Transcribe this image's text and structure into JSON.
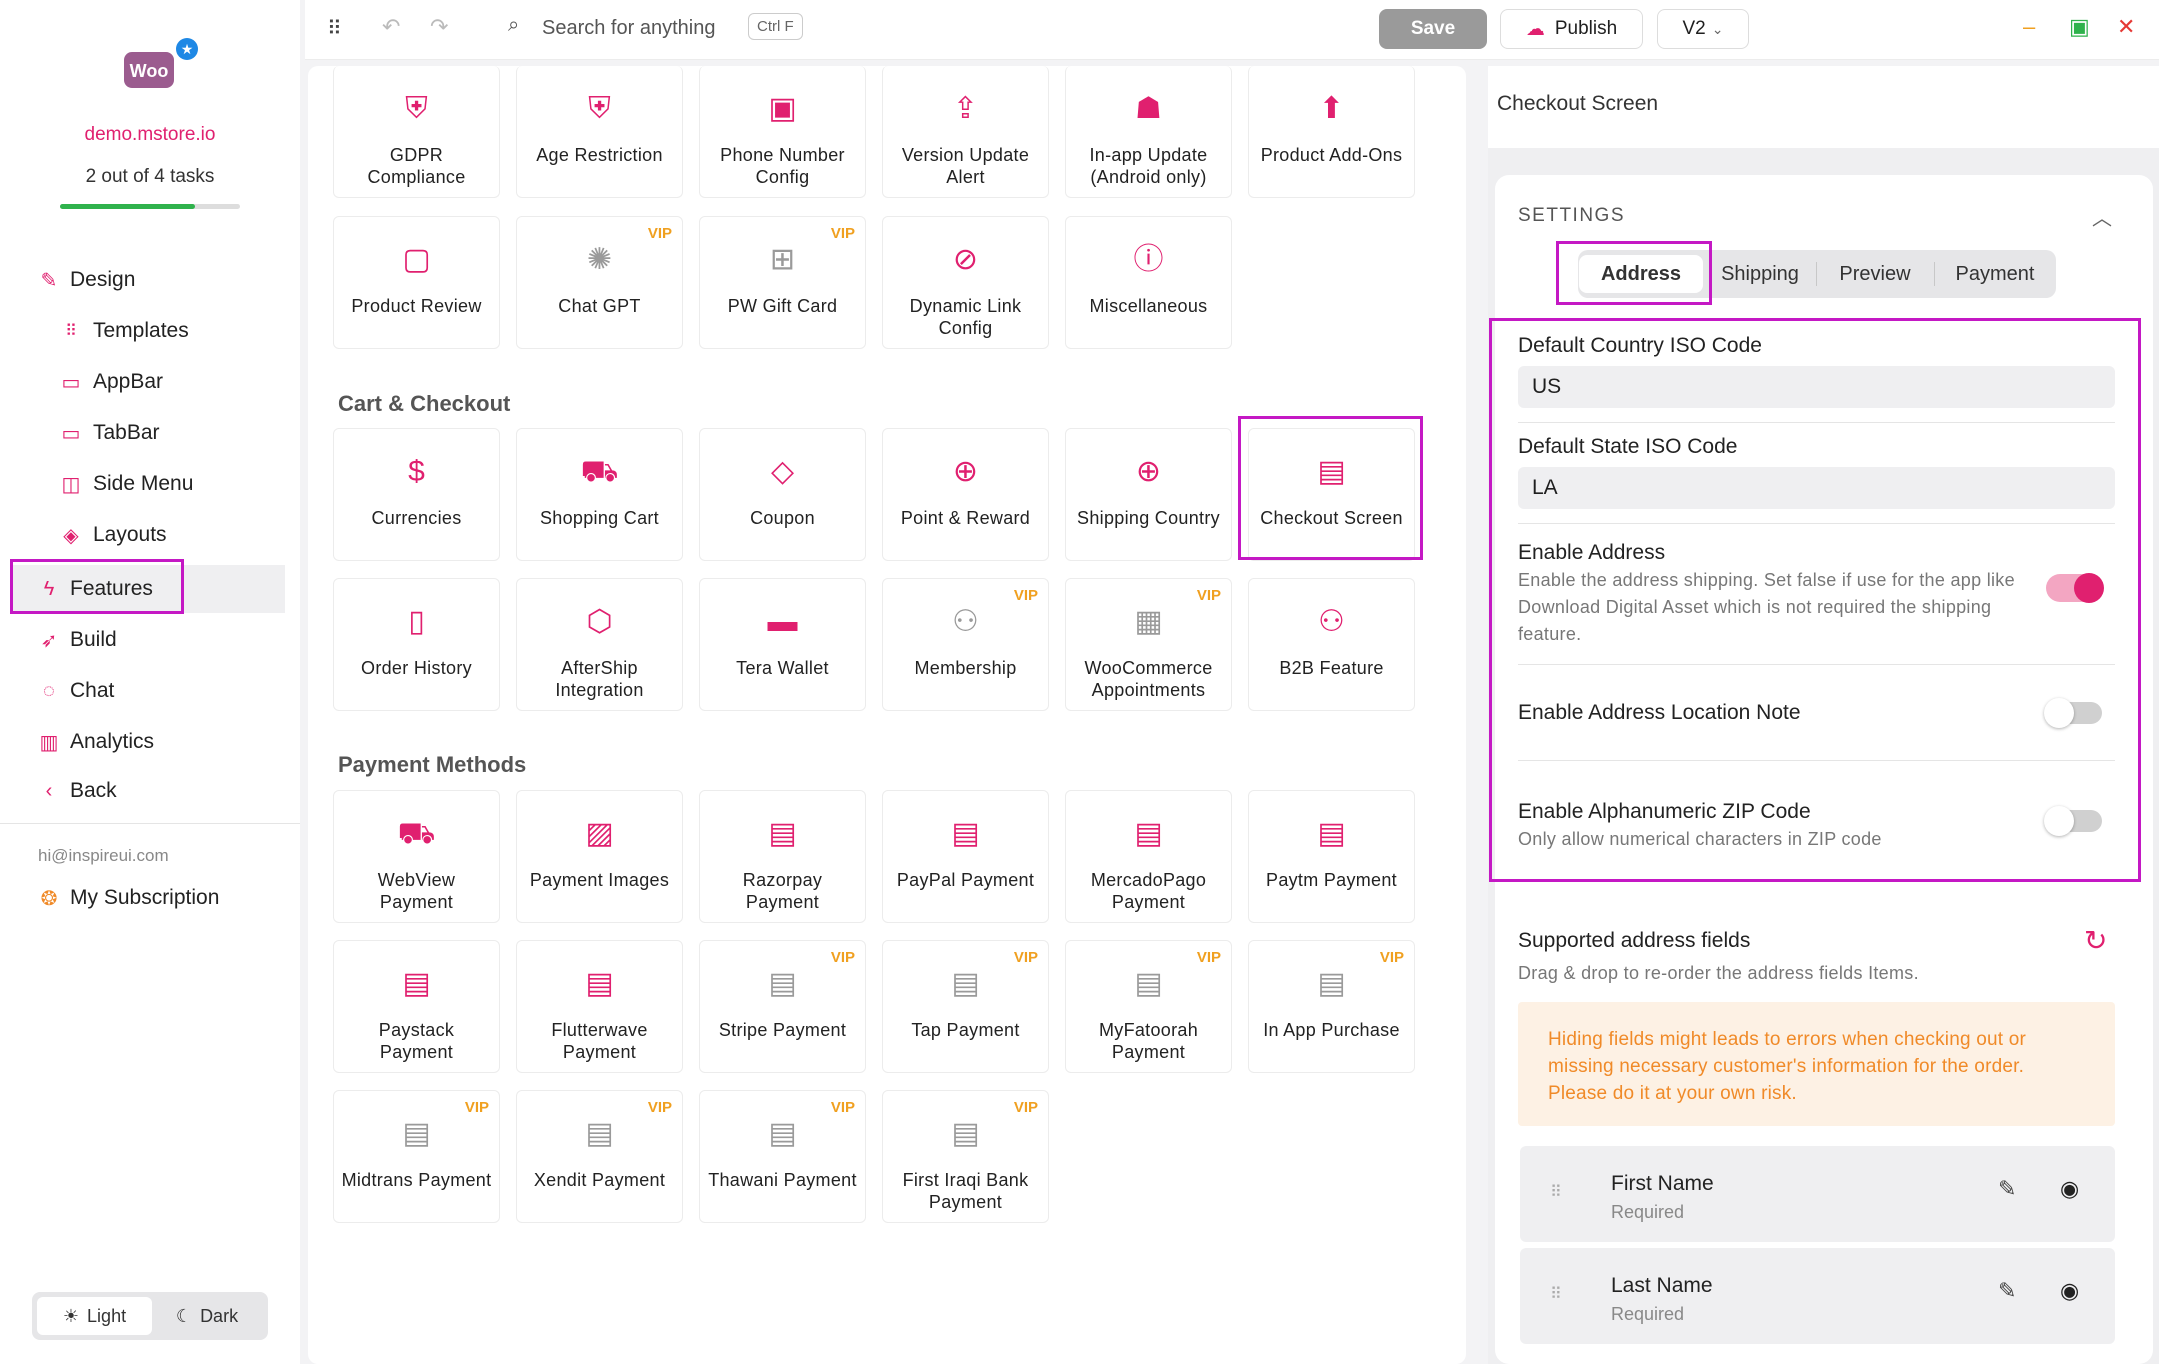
{
  "sidebar": {
    "store_name": "demo.mstore.io",
    "tasks": "2 out of 4 tasks",
    "tasks_progress": 0.75,
    "nav": [
      {
        "label": "Design",
        "icon": "brush-icon"
      },
      {
        "label": "Templates",
        "icon": "grid-dots-icon"
      },
      {
        "label": "AppBar",
        "icon": "appbar-icon"
      },
      {
        "label": "TabBar",
        "icon": "tabbar-icon"
      },
      {
        "label": "Side Menu",
        "icon": "side-menu-icon"
      },
      {
        "label": "Layouts",
        "icon": "layers-icon"
      },
      {
        "label": "Features",
        "icon": "lightning-icon"
      },
      {
        "label": "Build",
        "icon": "rocket-icon"
      },
      {
        "label": "Chat",
        "icon": "chat-icon"
      },
      {
        "label": "Analytics",
        "icon": "bar-chart-icon"
      },
      {
        "label": "Back",
        "icon": "chevron-left-icon"
      }
    ],
    "email": "hi@inspireui.com",
    "subscription": "My Subscription",
    "theme_light": "Light",
    "theme_dark": "Dark"
  },
  "topbar": {
    "search_placeholder": "Search for anything",
    "shortcut": "Ctrl F",
    "save": "Save",
    "publish": "Publish",
    "version": "V2"
  },
  "features": {
    "top_row": [
      {
        "label": "GDPR Compliance",
        "icon": "shield-icon"
      },
      {
        "label": "Age Restriction",
        "icon": "shield-icon"
      },
      {
        "label": "Phone Number Config",
        "icon": "id-card-icon"
      },
      {
        "label": "Version Update Alert",
        "icon": "upload-icon"
      },
      {
        "label": "In-app Update (Android only)",
        "icon": "android-icon"
      },
      {
        "label": "Product Add-Ons",
        "icon": "upload-arrow-icon"
      }
    ],
    "second_row": [
      {
        "label": "Product Review",
        "icon": "comment-icon",
        "vip": ""
      },
      {
        "label": "Chat GPT",
        "icon": "openai-icon",
        "vip": "VIP",
        "gray": true
      },
      {
        "label": "PW Gift Card",
        "icon": "gift-icon",
        "vip": "VIP",
        "gray": true
      },
      {
        "label": "Dynamic Link Config",
        "icon": "link-icon",
        "vip": ""
      },
      {
        "label": "Miscellaneous",
        "icon": "alert-icon",
        "vip": ""
      }
    ],
    "cart_title": "Cart & Checkout",
    "cart": [
      {
        "label": "Currencies",
        "icon": "dollar-icon",
        "vip": ""
      },
      {
        "label": "Shopping Cart",
        "icon": "cart-icon",
        "vip": ""
      },
      {
        "label": "Coupon",
        "icon": "tag-icon",
        "vip": ""
      },
      {
        "label": "Point & Reward",
        "icon": "reward-icon",
        "vip": ""
      },
      {
        "label": "Shipping Country",
        "icon": "globe-icon",
        "vip": ""
      },
      {
        "label": "Checkout Screen",
        "icon": "card-icon",
        "vip": ""
      },
      {
        "label": "Order History",
        "icon": "document-icon",
        "vip": ""
      },
      {
        "label": "AfterShip Integration",
        "icon": "box-icon",
        "vip": ""
      },
      {
        "label": "Tera Wallet",
        "icon": "wallet-icon",
        "vip": ""
      },
      {
        "label": "Membership",
        "icon": "users-icon",
        "vip": "VIP",
        "gray": true
      },
      {
        "label": "WooCommerce Appointments",
        "icon": "calendar-icon",
        "vip": "VIP",
        "gray": true
      },
      {
        "label": "B2B Feature",
        "icon": "group-icon",
        "vip": ""
      }
    ],
    "payment_title": "Payment Methods",
    "payments": [
      {
        "label": "WebView Payment",
        "icon": "cart-plus-icon",
        "vip": ""
      },
      {
        "label": "Payment Images",
        "icon": "images-icon",
        "vip": ""
      },
      {
        "label": "Razorpay Payment",
        "icon": "card-icon",
        "vip": ""
      },
      {
        "label": "PayPal Payment",
        "icon": "card-icon",
        "vip": ""
      },
      {
        "label": "MercadoPago Payment",
        "icon": "card-icon",
        "vip": ""
      },
      {
        "label": "Paytm Payment",
        "icon": "card-icon",
        "vip": ""
      },
      {
        "label": "Paystack Payment",
        "icon": "card-icon",
        "vip": ""
      },
      {
        "label": "Flutterwave Payment",
        "icon": "card-icon",
        "vip": ""
      },
      {
        "label": "Stripe Payment",
        "icon": "card-icon",
        "vip": "VIP",
        "gray": true
      },
      {
        "label": "Tap Payment",
        "icon": "card-icon",
        "vip": "VIP",
        "gray": true
      },
      {
        "label": "MyFatoorah Payment",
        "icon": "card-icon",
        "vip": "VIP",
        "gray": true
      },
      {
        "label": "In App Purchase",
        "icon": "card-icon",
        "vip": "VIP",
        "gray": true
      },
      {
        "label": "Midtrans Payment",
        "icon": "card-icon",
        "vip": "VIP",
        "gray": true
      },
      {
        "label": "Xendit Payment",
        "icon": "card-icon",
        "vip": "VIP",
        "gray": true
      },
      {
        "label": "Thawani Payment",
        "icon": "card-icon",
        "vip": "VIP",
        "gray": true
      },
      {
        "label": "First Iraqi Bank Payment",
        "icon": "card-icon",
        "vip": "VIP",
        "gray": true
      }
    ]
  },
  "panel": {
    "title": "Checkout Screen",
    "settings_label": "SETTINGS",
    "tabs": [
      "Address",
      "Shipping",
      "Preview",
      "Payment"
    ],
    "country_label": "Default Country ISO Code",
    "country_value": "US",
    "state_label": "Default State ISO Code",
    "state_value": "LA",
    "enable_address_label": "Enable Address",
    "enable_address_desc": "Enable the address shipping. Set false if use for the app like Download Digital Asset which is not required the shipping feature.",
    "enable_address_on": true,
    "location_note_label": "Enable Address Location Note",
    "location_note_on": false,
    "zip_label": "Enable Alphanumeric ZIP Code",
    "zip_desc": "Only allow numerical characters in ZIP code",
    "zip_on": false,
    "supported_label": "Supported address fields",
    "supported_desc": "Drag & drop to re-order the address fields Items.",
    "warning": "Hiding fields might leads to errors when checking out or missing necessary customer's information for the order. Please do it at your own risk.",
    "fields": [
      {
        "name": "First Name",
        "status": "Required"
      },
      {
        "name": "Last Name",
        "status": "Required"
      }
    ]
  },
  "colors": {
    "accent": "#e0206f",
    "highlight": "#c418c4",
    "vip": "#f0a020"
  }
}
